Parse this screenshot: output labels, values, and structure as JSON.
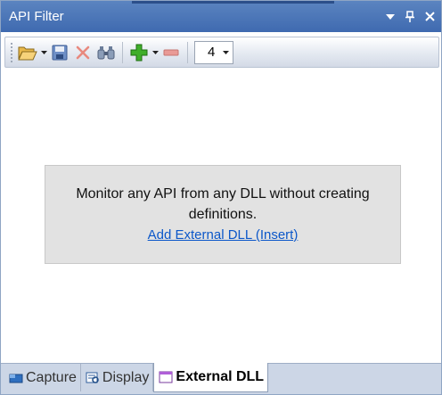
{
  "window": {
    "title": "API Filter",
    "buttons": {
      "menu": "▼",
      "pin": "📌",
      "close": "✕"
    }
  },
  "toolbar": {
    "items": [
      {
        "name": "open",
        "icon": "folder-open-icon"
      },
      {
        "name": "save",
        "icon": "save-icon"
      },
      {
        "name": "delete",
        "icon": "delete-icon"
      },
      {
        "name": "find",
        "icon": "binoculars-icon"
      },
      {
        "name": "add",
        "icon": "plus-icon"
      },
      {
        "name": "remove",
        "icon": "minus-icon"
      }
    ],
    "combo_value": "4"
  },
  "content": {
    "message": "Monitor any API from any DLL without creating definitions.",
    "link": "Add External DLL (Insert)"
  },
  "tabs": [
    {
      "label": "Capture",
      "icon": "capture-icon",
      "active": false
    },
    {
      "label": "Display",
      "icon": "display-icon",
      "active": false
    },
    {
      "label": "External DLL",
      "icon": "window-icon",
      "active": true
    }
  ],
  "colors": {
    "title_bar": "#4a76b8",
    "link": "#0b57c9",
    "info_box": "#e2e2e2",
    "tab_bar": "#ccd6e6"
  }
}
